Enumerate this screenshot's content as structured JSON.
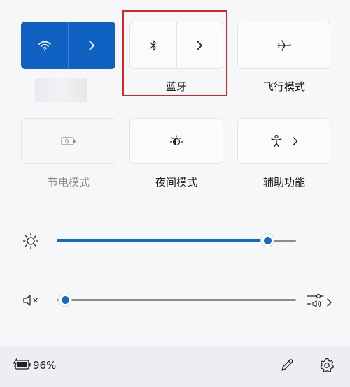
{
  "quick_settings": {
    "row1": {
      "wifi": {
        "icon": "wifi-icon",
        "expand_icon": "chevron-right-icon",
        "state": "on",
        "label": ""
      },
      "bluetooth": {
        "icon": "bluetooth-icon",
        "expand_icon": "chevron-right-icon",
        "label": "蓝牙"
      },
      "airplane": {
        "icon": "airplane-icon",
        "label": "飞行模式"
      }
    },
    "row2": {
      "battery_saver": {
        "icon": "battery-saver-icon",
        "label": "节电模式",
        "state": "disabled"
      },
      "night_light": {
        "icon": "night-light-icon",
        "label": "夜间模式"
      },
      "accessibility": {
        "icon": "accessibility-icon",
        "expand_icon": "chevron-right-icon",
        "label": "辅助功能"
      }
    }
  },
  "sliders": {
    "brightness": {
      "icon": "brightness-icon",
      "value_percent": 100
    },
    "volume": {
      "icon": "volume-muted-icon",
      "value_percent": 0,
      "output_icon": "audio-output-select-icon"
    }
  },
  "footer": {
    "battery_icon": "battery-charging-icon",
    "battery_percent": "96%",
    "edit_icon": "pencil-icon",
    "settings_icon": "gear-icon"
  },
  "colors": {
    "accent": "#0f62c2",
    "highlight_box": "#d9252a"
  }
}
